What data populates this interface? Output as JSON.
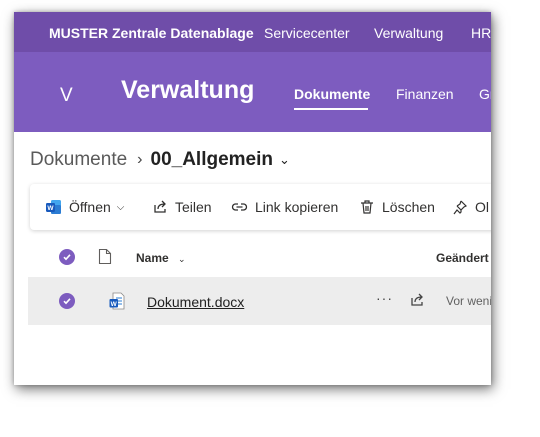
{
  "topbar": {
    "brand": "MUSTER Zentrale Datenablage",
    "links": [
      "Servicecenter",
      "Verwaltung",
      "HR"
    ]
  },
  "site": {
    "logo_letter": "V",
    "title": "Verwaltung",
    "nav": [
      "Dokumente",
      "Finanzen",
      "Gr"
    ]
  },
  "breadcrumb": {
    "root": "Dokumente",
    "current": "00_Allgemein"
  },
  "commands": {
    "open": "Öffnen",
    "share": "Teilen",
    "copy_link": "Link kopieren",
    "delete": "Löschen",
    "pin": "Ol"
  },
  "list": {
    "columns": {
      "name": "Name",
      "modified": "Geändert"
    },
    "rows": [
      {
        "name": "Dokument.docx",
        "modified": "Vor wenige"
      }
    ]
  },
  "colors": {
    "suite_bar": "#6f4da9",
    "site_header": "#7d5cbf",
    "accent": "#7d5cbf",
    "selected_row": "#ededed",
    "word_blue": "#185abd"
  }
}
